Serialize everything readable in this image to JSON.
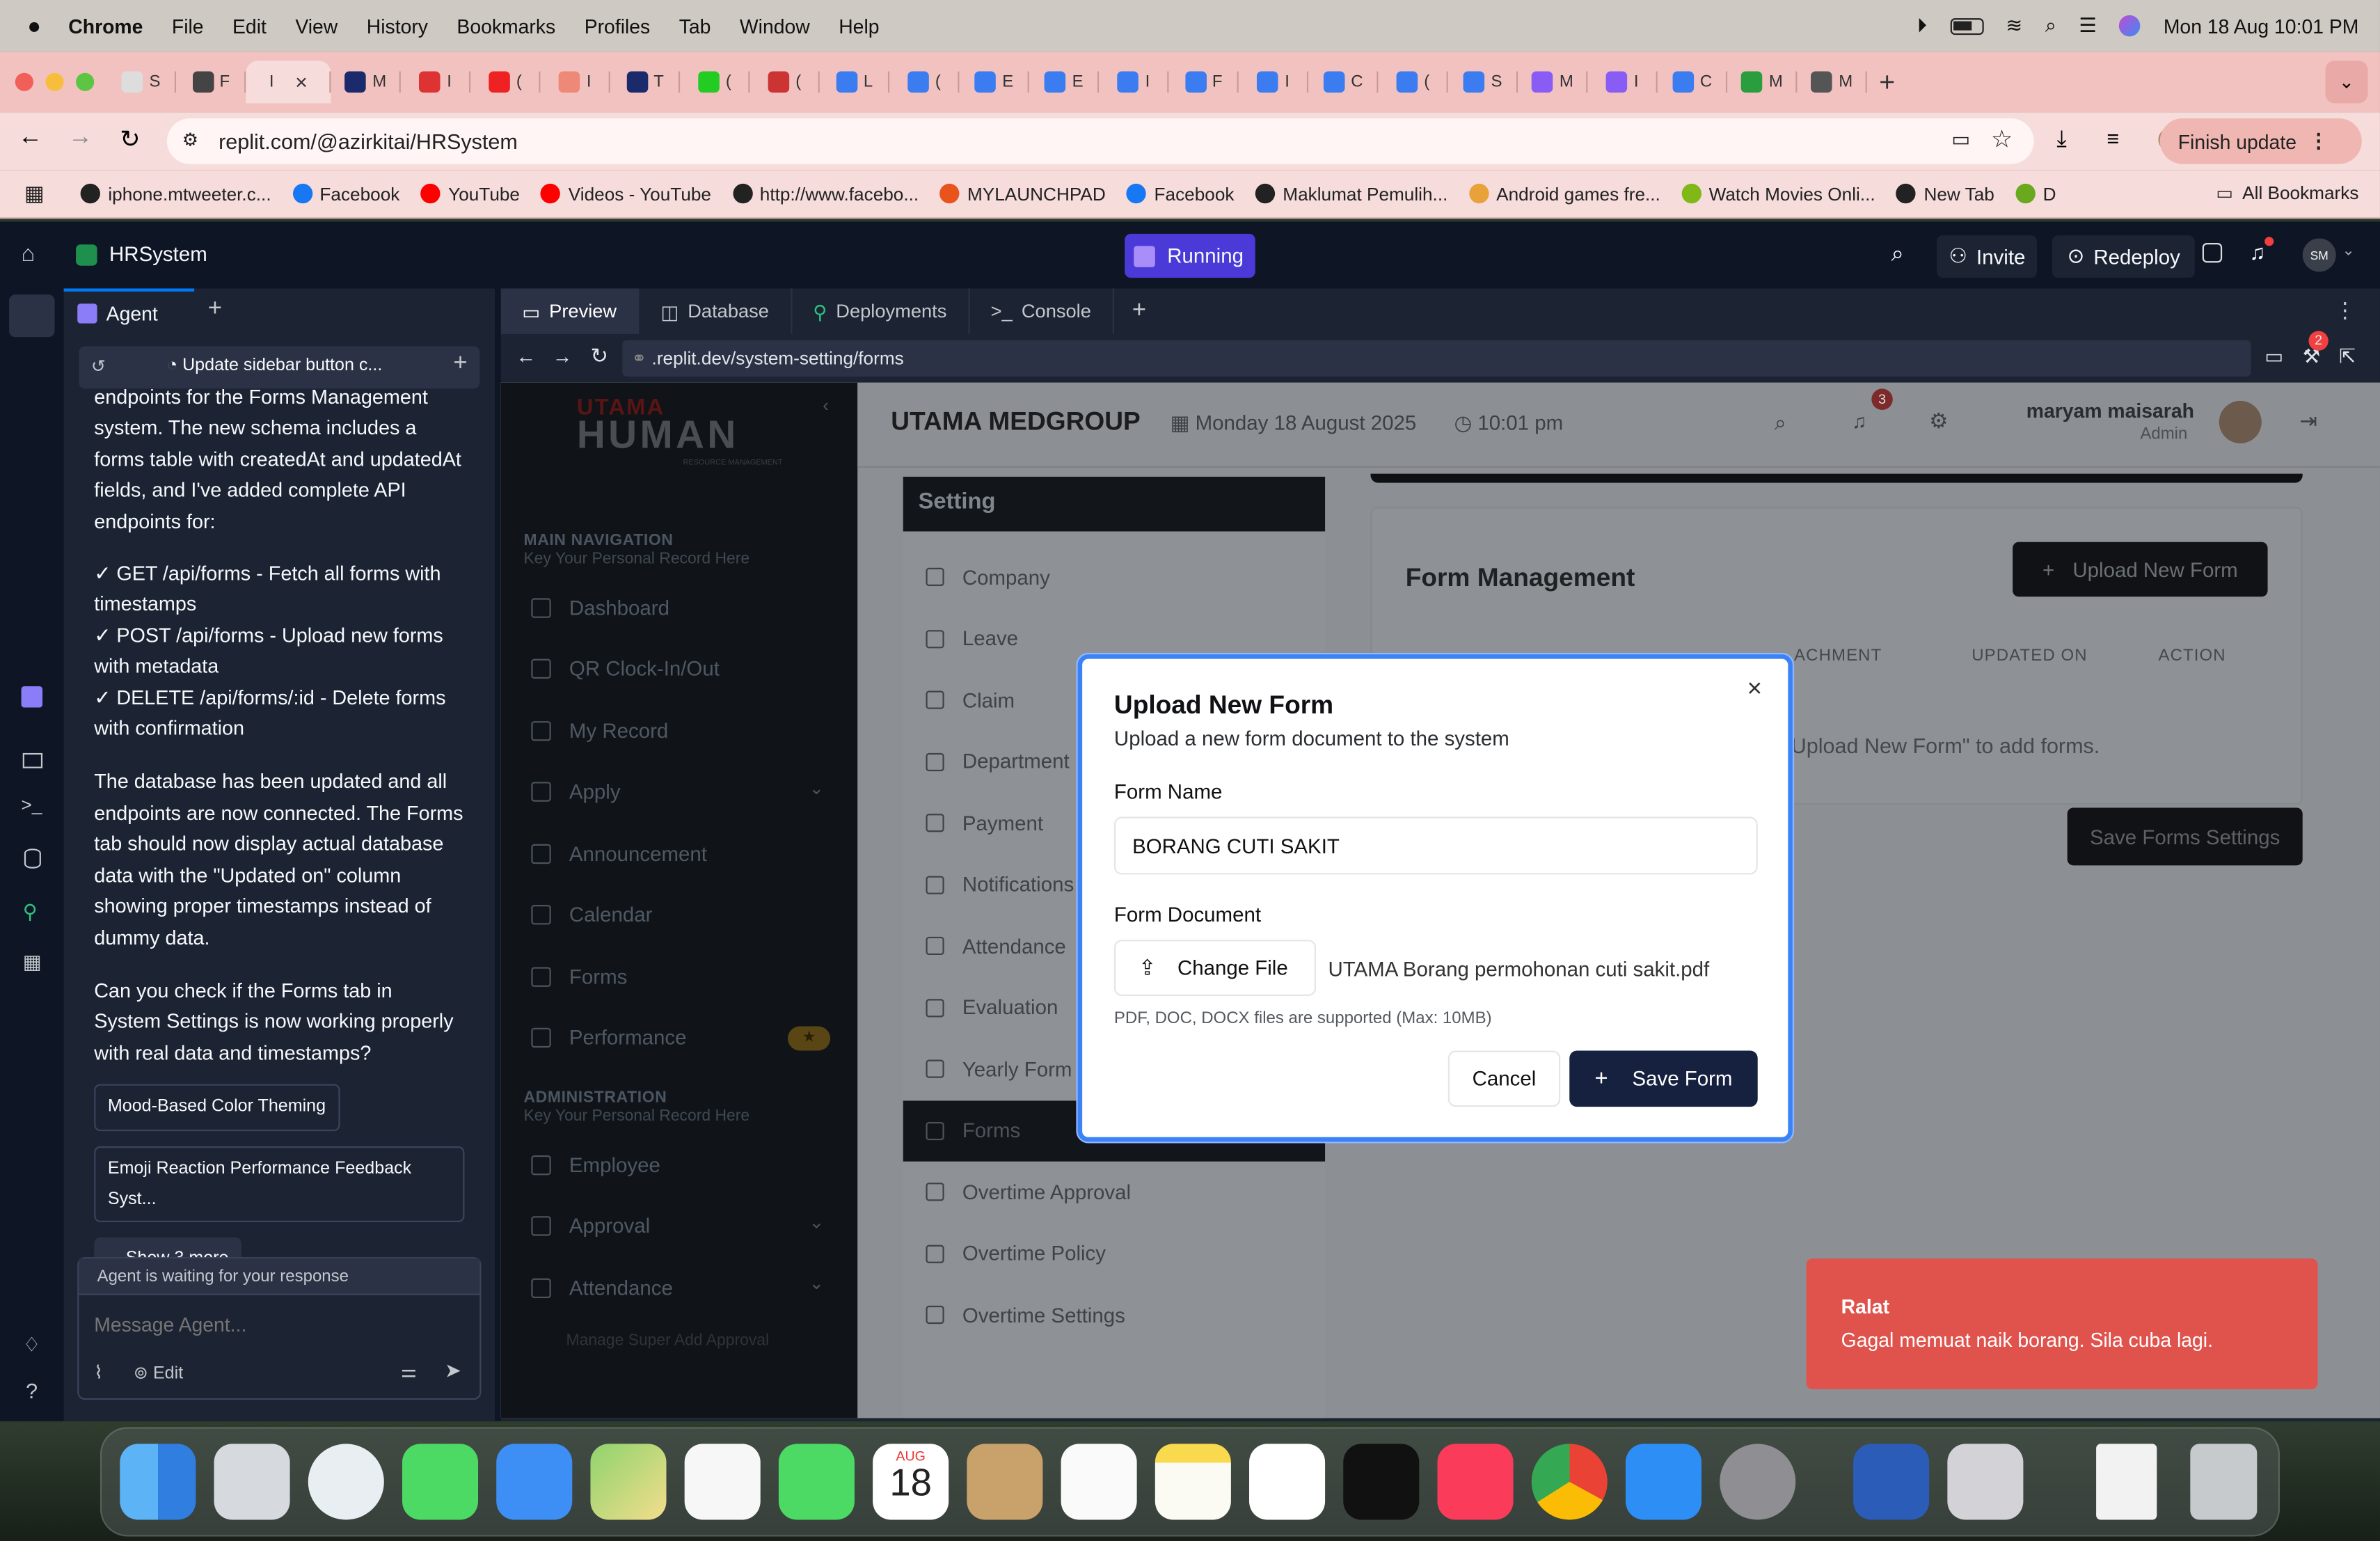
{
  "menubar": {
    "apple": "apple-icon",
    "app": "Chrome",
    "items": [
      "File",
      "Edit",
      "View",
      "History",
      "Bookmarks",
      "Profiles",
      "Tab",
      "Window",
      "Help"
    ],
    "datetime": "Mon 18 Aug  10:01 PM"
  },
  "browser": {
    "url": "replit.com/@azirkitai/HRSystem",
    "finish_update": "Finish update",
    "bookmarks": [
      "iphone.mtweeter.c...",
      "Facebook",
      "YouTube",
      "Videos - YouTube",
      "http://www.facebo...",
      "MYLAUNCHPAD",
      "Facebook",
      "Maklumat Pemulih...",
      "Android games fre...",
      "Watch Movies Onli...",
      "New Tab",
      "D"
    ],
    "all_bookmarks": "All Bookmarks",
    "active_tab_label": "I",
    "tab_labels": [
      "S",
      "F",
      "",
      "M",
      "I",
      "(",
      "I",
      "T",
      "(",
      "(",
      "L",
      "(",
      "E",
      "E",
      "I",
      "F",
      "I",
      "C",
      "(",
      "S",
      "M",
      "I",
      "C",
      "M",
      "M"
    ]
  },
  "replit": {
    "project": "HRSystem",
    "run_status": "Running",
    "invite": "Invite",
    "redeploy": "Redeploy",
    "avatar": "SM",
    "agent_tab": "Agent",
    "agent_thread": "Update sidebar button c...",
    "agent_messages": [
      "endpoints for the Forms Management system. The new schema includes a forms table with createdAt and updatedAt fields, and I've added complete API endpoints for:",
      "✓ GET /api/forms - Fetch all forms with timestamps",
      "✓ POST /api/forms - Upload new forms with metadata",
      "✓ DELETE /api/forms/:id - Delete forms with confirmation",
      "The database has been updated and all endpoints are now connected. The Forms tab should now display actual database data with the \"Updated on\" column showing proper timestamps instead of dummy data.",
      "Can you check if the Forms tab in System Settings is now working properly with real data and timestamps?"
    ],
    "suggestions": [
      "Mood-Based Color Theming",
      "Emoji Reaction Performance Feedback Syst..."
    ],
    "show_more": "Show 3 more",
    "agent_status": "Agent is waiting for your response",
    "message_placeholder": "Message Agent...",
    "edit_label": "Edit",
    "pane_tabs": [
      "Preview",
      "Database",
      "Deployments",
      "Console"
    ],
    "preview_url": ".replit.dev/system-setting/forms",
    "preview_badge": "2"
  },
  "app": {
    "logo_top": "UTAMA",
    "logo_main": "HUMAN",
    "logo_sub": "RESOURCE MANAGEMENT",
    "main_nav_title": "MAIN NAVIGATION",
    "main_nav_sub": "Key Your Personal Record Here",
    "main_nav": [
      "Dashboard",
      "QR Clock-In/Out",
      "My Record",
      "Apply",
      "Announcement",
      "Calendar",
      "Forms",
      "Performance"
    ],
    "admin_title": "ADMINISTRATION",
    "admin_sub": "Key Your Personal Record Here",
    "admin_nav": [
      "Employee",
      "Approval",
      "Attendance"
    ],
    "admin_footer": "Manage Super Add Approval",
    "company": "UTAMA MEDGROUP",
    "date": "Monday 18 August 2025",
    "time": "10:01 pm",
    "notif_count": "3",
    "user_name": "maryam maisarah",
    "user_role": "Admin",
    "setting_title": "Setting",
    "settings": [
      "Company",
      "Leave",
      "Claim",
      "Department",
      "Payment",
      "Notifications",
      "Attendance",
      "Evaluation",
      "Yearly Form",
      "Forms",
      "Overtime Approval",
      "Overtime Policy",
      "Overtime Settings"
    ],
    "form_mgmt_title": "Form Management",
    "upload_btn": "Upload New Form",
    "cols": [
      "ACHMENT",
      "UPDATED ON",
      "ACTION"
    ],
    "empty_text": "Upload New Form\" to add forms.",
    "save_settings": "Save Forms Settings"
  },
  "modal": {
    "title": "Upload New Form",
    "subtitle": "Upload a new form document to the system",
    "name_label": "Form Name",
    "name_value": "BORANG CUTI SAKIT",
    "doc_label": "Form Document",
    "change_file": "Change File",
    "file_name": "UTAMA Borang permohonan cuti sakit.pdf",
    "hint": "PDF, DOC, DOCX files are supported (Max: 10MB)",
    "cancel": "Cancel",
    "save": "Save Form"
  },
  "toast": {
    "title": "Ralat",
    "message": "Gagal memuat naik borang. Sila cuba lagi."
  },
  "dock": {
    "calendar_month": "AUG",
    "calendar_day": "18"
  }
}
